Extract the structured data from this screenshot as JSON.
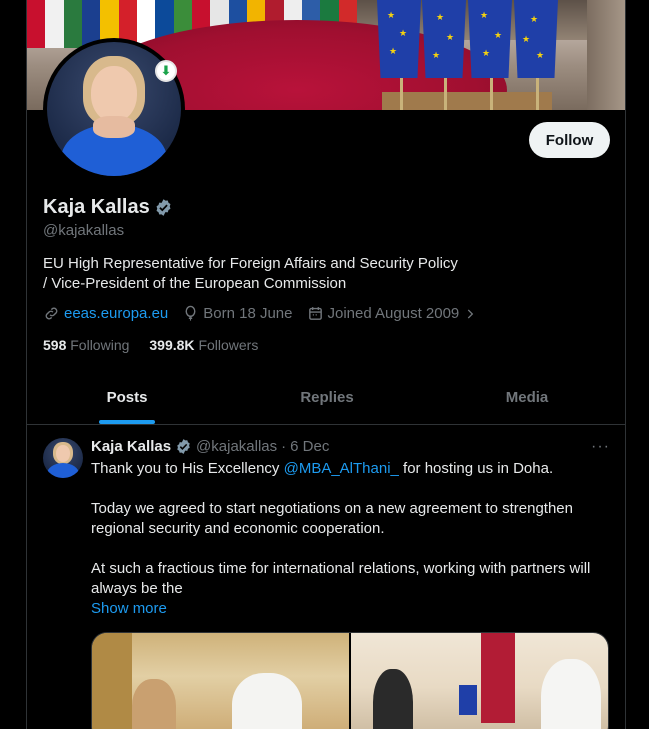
{
  "profile": {
    "name": "Kaja Kallas",
    "handle": "@kajakallas",
    "follow_label": "Follow",
    "bio": "EU High Representative for Foreign Affairs and Security Policy\n/ Vice-President of the European Commission",
    "website": "eeas.europa.eu",
    "born": "Born 18 June",
    "joined": "Joined August 2009",
    "following_count": "598",
    "following_label": "Following",
    "followers_count": "399.8K",
    "followers_label": "Followers"
  },
  "tabs": [
    {
      "label": "Posts",
      "active": true
    },
    {
      "label": "Replies",
      "active": false
    },
    {
      "label": "Media",
      "active": false
    }
  ],
  "post": {
    "author_name": "Kaja Kallas",
    "author_handle": "@kajakallas",
    "separator": "·",
    "date": "6 Dec",
    "more": "···",
    "text_before_mention": "Thank you to His Excellency ",
    "mention": "@MBA_AlThani_",
    "text_after_mention": " for hosting us in Doha.\n\nToday we agreed to start negotiations on a new agreement to strengthen regional security and economic cooperation.\n\nAt such a fractious time for international relations, working with partners will always be the",
    "show_more": "Show more"
  },
  "colors": {
    "accent": "#1d9bf0",
    "background": "#000000",
    "text_primary": "#e7e9ea",
    "text_secondary": "#71767b"
  }
}
